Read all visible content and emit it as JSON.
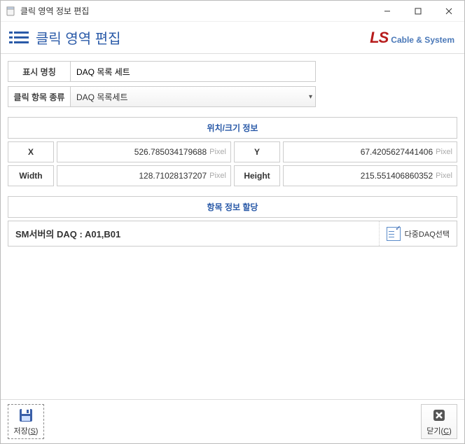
{
  "titlebar": {
    "title": "클릭 영역 정보 편집"
  },
  "header": {
    "page_title": "클릭 영역 편집",
    "logo_main": "LS",
    "logo_sub": "Cable & System"
  },
  "form": {
    "display_name_label": "표시 명칭",
    "display_name_value": "DAQ 목록 세트",
    "click_type_label": "클릭 항목 종류",
    "click_type_value": "DAQ 목록세트"
  },
  "position_section": {
    "title": "위치/크기 정보",
    "x_label": "X",
    "x_value": "526.785034179688",
    "y_label": "Y",
    "y_value": "67.4205627441406",
    "width_label": "Width",
    "width_value": "128.71028137207",
    "height_label": "Height",
    "height_value": "215.551406860352",
    "unit": "Pixel"
  },
  "assign_section": {
    "title": "항목 정보 할당",
    "text": "SM서버의 DAQ : A01,B01",
    "multi_btn": "다중DAQ선택"
  },
  "footer": {
    "save_label": "저장(",
    "save_key": "S",
    "save_tail": ")",
    "close_label": "닫기(",
    "close_key": "C",
    "close_tail": ")"
  }
}
